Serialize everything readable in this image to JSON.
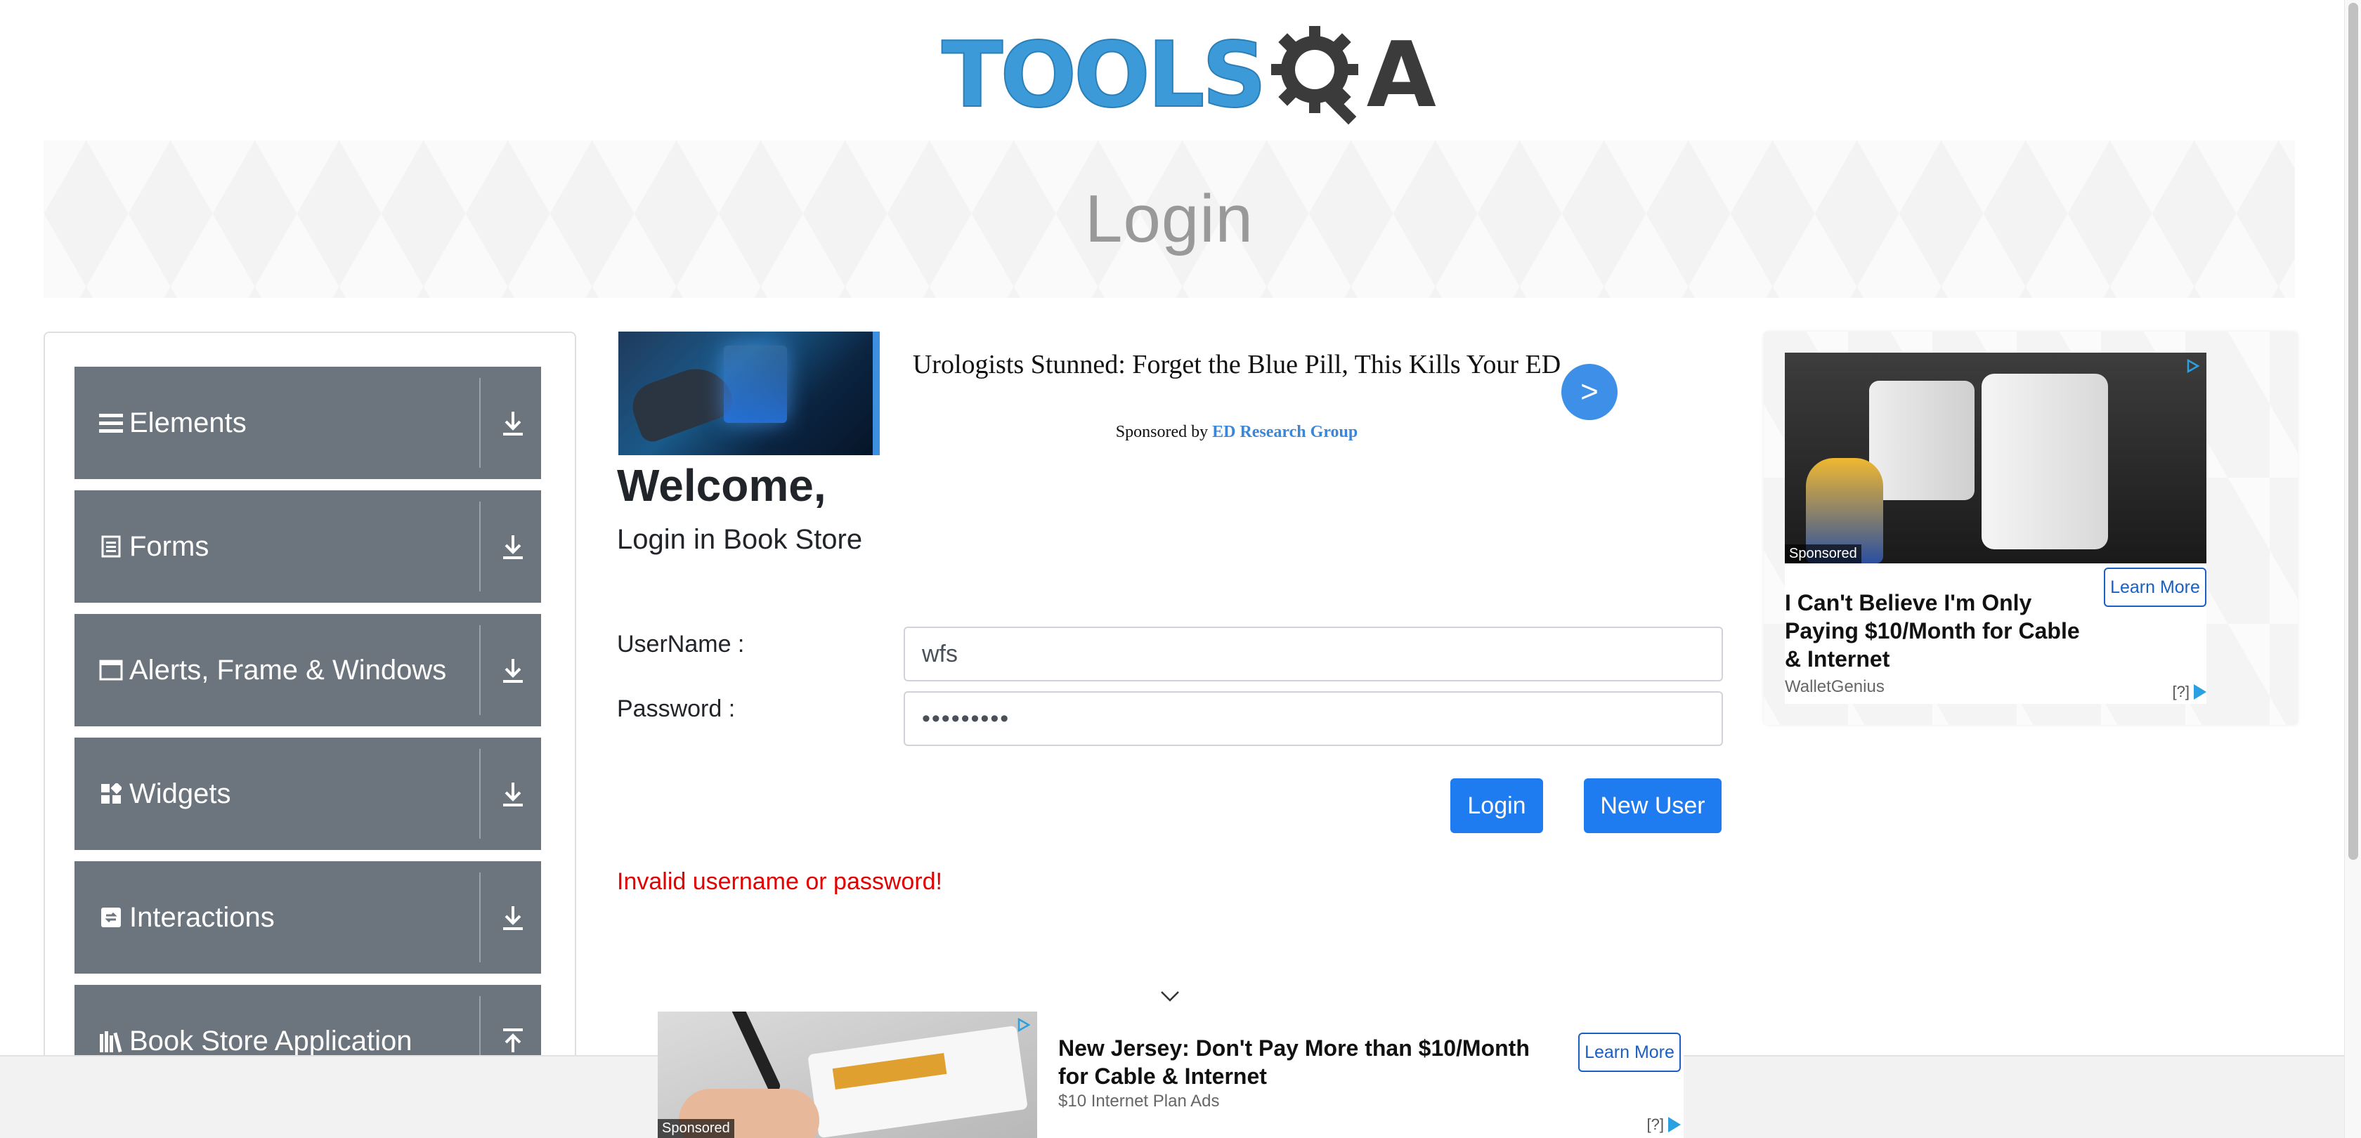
{
  "logo": {
    "left_text": "TOOLS",
    "right_text": "A"
  },
  "banner": {
    "title": "Login"
  },
  "sidebar": {
    "groups": [
      {
        "label": "Elements",
        "icon": "hamburger-icon"
      },
      {
        "label": "Forms",
        "icon": "document-icon"
      },
      {
        "label": "Alerts, Frame & Windows",
        "icon": "window-icon"
      },
      {
        "label": "Widgets",
        "icon": "widgets-icon"
      },
      {
        "label": "Interactions",
        "icon": "interactions-icon"
      },
      {
        "label": "Book Store Application",
        "icon": "books-icon"
      }
    ]
  },
  "top_ad": {
    "headline": "Urologists Stunned: Forget the Blue Pill, This Kills Your ED",
    "sponsored_by": "Sponsored by",
    "sponsor_name": "ED Research Group",
    "go_label": ">"
  },
  "login": {
    "welcome": "Welcome,",
    "subtitle": "Login in Book Store",
    "username_label": "UserName :",
    "username_value": "wfs",
    "password_label": "Password :",
    "password_value": "•••••••••",
    "login_button": "Login",
    "new_user_button": "New User",
    "error": "Invalid username or password!"
  },
  "right_ad": {
    "sponsored": "Sponsored",
    "title": "I Can't Believe I'm Only Paying $10/Month for Cable & Internet",
    "source": "WalletGenius",
    "cta": "Learn More",
    "adchoice": "[?]"
  },
  "bottom_ad": {
    "sponsored": "Sponsored",
    "title": "New Jersey: Don't Pay More than $10/Month for Cable & Internet",
    "source": "$10 Internet Plan Ads",
    "cta": "Learn More",
    "adchoice": "[?]"
  },
  "colors": {
    "menu_bg": "#6c757d",
    "primary": "#1f7bf0",
    "error": "#e30000",
    "logo_blue": "#3d9ad8"
  }
}
